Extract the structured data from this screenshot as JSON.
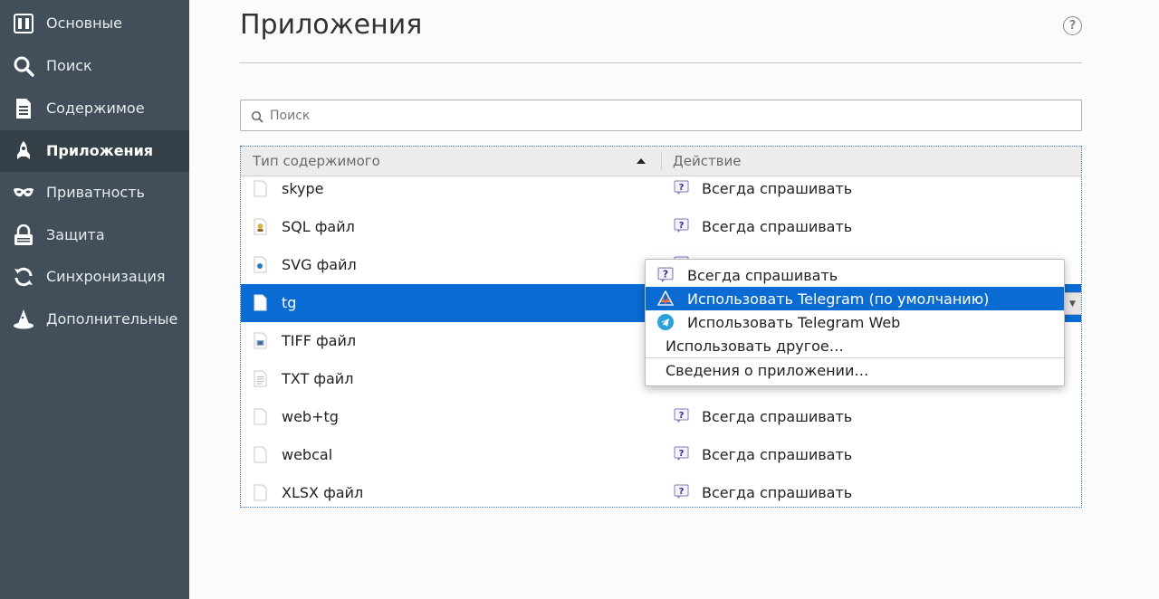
{
  "sidebar": {
    "items": [
      {
        "label": "Основные",
        "icon": "general-icon"
      },
      {
        "label": "Поиск",
        "icon": "search-icon"
      },
      {
        "label": "Содержимое",
        "icon": "content-icon"
      },
      {
        "label": "Приложения",
        "icon": "rocket-icon",
        "active": true
      },
      {
        "label": "Приватность",
        "icon": "mask-icon"
      },
      {
        "label": "Защита",
        "icon": "lock-icon"
      },
      {
        "label": "Синхронизация",
        "icon": "sync-icon"
      },
      {
        "label": "Дополнительные",
        "icon": "wizard-hat-icon"
      }
    ]
  },
  "page": {
    "title": "Приложения",
    "help_symbol": "?"
  },
  "search": {
    "placeholder": "Поиск",
    "value": ""
  },
  "table": {
    "col_type": "Тип содержимого",
    "col_action": "Действие",
    "sort": "ascending",
    "rows": [
      {
        "name": "skype",
        "action": "Всегда спрашивать",
        "icon": "generic-file-icon"
      },
      {
        "name": "SQL файл",
        "action": "Всегда спрашивать",
        "icon": "sql-file-icon"
      },
      {
        "name": "SVG файл",
        "action": "",
        "icon": "svg-file-icon"
      },
      {
        "name": "tg",
        "action": "",
        "icon": "generic-file-icon",
        "selected": true
      },
      {
        "name": "TIFF файл",
        "action": "",
        "icon": "image-file-icon"
      },
      {
        "name": "TXT файл",
        "action": "",
        "icon": "text-file-icon"
      },
      {
        "name": "web+tg",
        "action": "Всегда спрашивать",
        "icon": "generic-file-icon"
      },
      {
        "name": "webcal",
        "action": "Всегда спрашивать",
        "icon": "generic-file-icon"
      },
      {
        "name": "XLSX файл",
        "action": "Всегда спрашивать",
        "icon": "generic-file-icon"
      }
    ]
  },
  "popup": {
    "items": [
      {
        "label": "Всегда спрашивать",
        "icon": "ask-icon"
      },
      {
        "label": "Использовать Telegram (по умолчанию)",
        "icon": "telegram-app-icon",
        "highlighted": true
      },
      {
        "label": "Использовать Telegram Web",
        "icon": "telegram-icon"
      },
      {
        "label": "Использовать другое…"
      },
      {
        "label": "Сведения о приложении…"
      }
    ]
  },
  "colors": {
    "sidebar_bg": "#424f5a",
    "sidebar_active": "#343f48",
    "selection": "#0a6bd3",
    "telegram": "#2aa1da"
  }
}
